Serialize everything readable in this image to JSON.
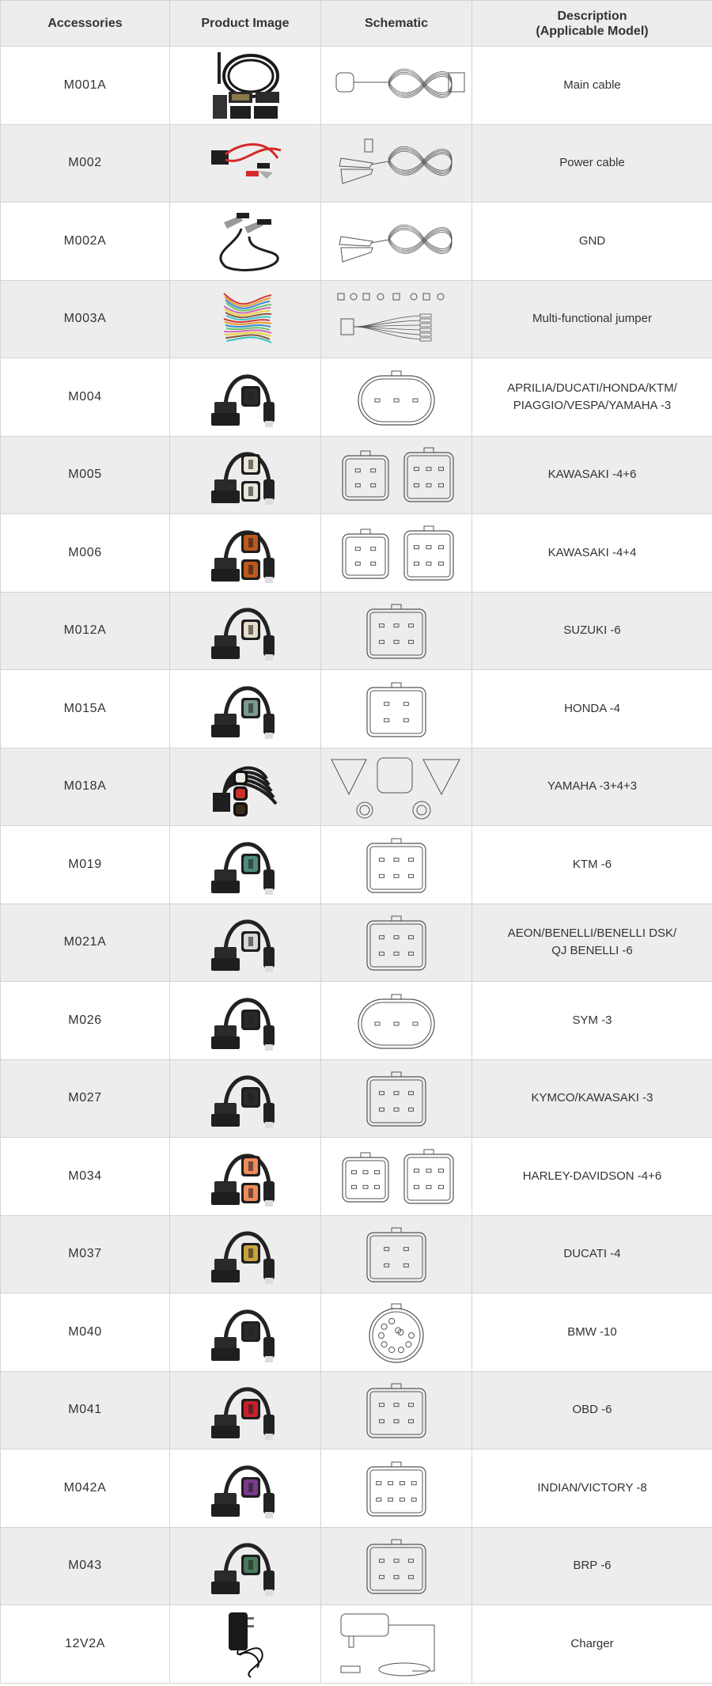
{
  "header": {
    "accessories": "Accessories",
    "product_image": "Product Image",
    "schematic": "Schematic",
    "description_line1": "Description",
    "description_line2": "(Applicable Model)"
  },
  "colors": {
    "header_bg": "#ededed",
    "row_alt_bg": "#ededed",
    "border": "#d4d4d4",
    "text": "#333333"
  },
  "rows": [
    {
      "code": "M001A",
      "desc1": "Main cable",
      "desc2": "",
      "kind": "main",
      "image": "main-cable-photo",
      "schematic": "main-cable-schematic"
    },
    {
      "code": "M002",
      "desc1": "Power cable",
      "desc2": "",
      "kind": "power",
      "image": "power-cable-photo",
      "schematic": "power-cable-schematic"
    },
    {
      "code": "M002A",
      "desc1": "GND",
      "desc2": "",
      "kind": "gnd",
      "image": "gnd-cable-photo",
      "schematic": "gnd-cable-schematic"
    },
    {
      "code": "M003A",
      "desc1": "Multi-functional jumper",
      "desc2": "",
      "kind": "jumper",
      "image": "jumper-photo",
      "schematic": "jumper-schematic"
    },
    {
      "code": "M004",
      "desc1": "APRILIA/DUCATI/HONDA/KTM/",
      "desc2": "PIAGGIO/VESPA/YAMAHA -3",
      "kind": "adapter",
      "face": "#2a2a2a",
      "faces": 1,
      "pins": 3,
      "shape": "oval",
      "image": "m004-adapter-photo",
      "schematic": "m004-connector-schematic"
    },
    {
      "code": "M005",
      "desc1": "KAWASAKI -4+6",
      "desc2": "",
      "kind": "adapter",
      "face": "#e8e6d8",
      "faces": 2,
      "pins": 4,
      "shape": "square2",
      "image": "m005-adapter-photo",
      "schematic": "m005-connector-schematic"
    },
    {
      "code": "M006",
      "desc1": "KAWASAKI -4+4",
      "desc2": "",
      "kind": "adapter",
      "face": "#c0581c",
      "faces": 2,
      "pins": 4,
      "shape": "square2",
      "image": "m006-adapter-photo",
      "schematic": "m006-connector-schematic"
    },
    {
      "code": "M012A",
      "desc1": "SUZUKI -6",
      "desc2": "",
      "kind": "adapter",
      "face": "#e6dccb",
      "faces": 1,
      "pins": 6,
      "shape": "square",
      "image": "m012a-adapter-photo",
      "schematic": "m012a-connector-schematic"
    },
    {
      "code": "M015A",
      "desc1": "HONDA -4",
      "desc2": "",
      "kind": "adapter",
      "face": "#7a9a90",
      "faces": 1,
      "pins": 4,
      "shape": "square",
      "image": "m015a-adapter-photo",
      "schematic": "m015a-connector-schematic"
    },
    {
      "code": "M018A",
      "desc1": "YAMAHA -3+4+3",
      "desc2": "",
      "kind": "multi",
      "image": "m018a-adapter-photo",
      "schematic": "m018a-connector-schematic"
    },
    {
      "code": "M019",
      "desc1": "KTM -6",
      "desc2": "",
      "kind": "adapter",
      "face": "#4f8a7c",
      "faces": 1,
      "pins": 6,
      "shape": "rect",
      "image": "m019-adapter-photo",
      "schematic": "m019-connector-schematic"
    },
    {
      "code": "M021A",
      "desc1": "AEON/BENELLI/BENELLI DSK/",
      "desc2": "QJ BENELLI -6",
      "kind": "adapter",
      "face": "#d8d8d8",
      "faces": 1,
      "pins": 6,
      "shape": "rect",
      "image": "m021a-adapter-photo",
      "schematic": "m021a-connector-schematic"
    },
    {
      "code": "M026",
      "desc1": "SYM -3",
      "desc2": "",
      "kind": "adapter",
      "face": "#2a2a2a",
      "faces": 1,
      "pins": 3,
      "shape": "oval",
      "image": "m026-adapter-photo",
      "schematic": "m026-connector-schematic"
    },
    {
      "code": "M027",
      "desc1": "KYMCO/KAWASAKI -3",
      "desc2": "",
      "kind": "adapter",
      "face": "#2a2a2a",
      "faces": 1,
      "pins": 5,
      "shape": "square",
      "image": "m027-adapter-photo",
      "schematic": "m027-connector-schematic"
    },
    {
      "code": "M034",
      "desc1": "HARLEY-DAVIDSON -4+6",
      "desc2": "",
      "kind": "adapter",
      "face": "#f08a5a",
      "faces": 2,
      "pins": 6,
      "shape": "square2",
      "image": "m034-adapter-photo",
      "schematic": "m034-connector-schematic"
    },
    {
      "code": "M037",
      "desc1": "DUCATI -4",
      "desc2": "",
      "kind": "adapter",
      "face": "#c9a23a",
      "faces": 1,
      "pins": 4,
      "shape": "rect",
      "image": "m037-adapter-photo",
      "schematic": "m037-connector-schematic"
    },
    {
      "code": "M040",
      "desc1": "BMW -10",
      "desc2": "",
      "kind": "adapter",
      "face": "#2a2a2a",
      "faces": 1,
      "pins": 10,
      "shape": "round",
      "image": "m040-adapter-photo",
      "schematic": "m040-connector-schematic"
    },
    {
      "code": "M041",
      "desc1": "OBD -6",
      "desc2": "",
      "kind": "adapter",
      "face": "#c8202a",
      "faces": 1,
      "pins": 6,
      "shape": "square",
      "image": "m041-adapter-photo",
      "schematic": "m041-connector-schematic"
    },
    {
      "code": "M042A",
      "desc1": "INDIAN/VICTORY -8",
      "desc2": "",
      "kind": "adapter",
      "face": "#7a3a8a",
      "faces": 1,
      "pins": 8,
      "shape": "rect",
      "image": "m042a-adapter-photo",
      "schematic": "m042a-connector-schematic"
    },
    {
      "code": "M043",
      "desc1": "BRP -6",
      "desc2": "",
      "kind": "adapter",
      "face": "#4a7a5a",
      "faces": 1,
      "pins": 6,
      "shape": "square",
      "image": "m043-adapter-photo",
      "schematic": "m043-connector-schematic"
    },
    {
      "code": "12V2A",
      "desc1": "Charger",
      "desc2": "",
      "kind": "charger",
      "image": "charger-photo",
      "schematic": "charger-schematic"
    }
  ]
}
